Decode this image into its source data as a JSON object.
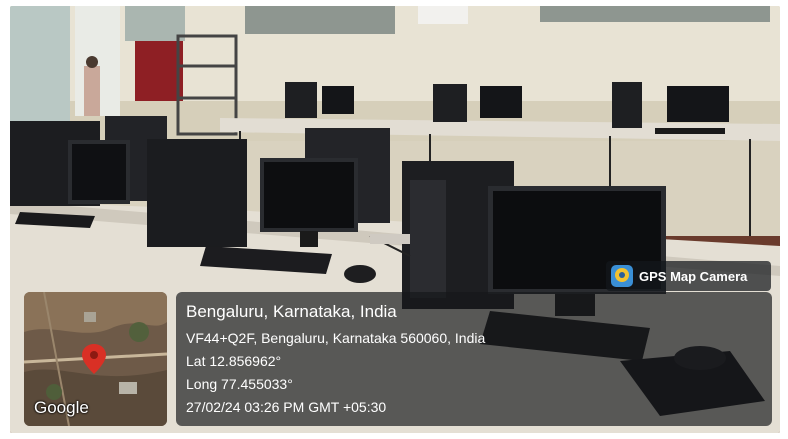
{
  "badge": {
    "label": "GPS Map Camera",
    "icon": "gps-map-camera-logo-icon"
  },
  "map": {
    "attribution": "Google",
    "marker_icon": "location-pin-icon",
    "marker_color": "#d93025"
  },
  "location": {
    "city_line": "Bengaluru, Karnataka, India",
    "address": "VF44+Q2F, Bengaluru, Karnataka 560060, India",
    "latitude": "Lat 12.856962°",
    "longitude": "Long 77.455033°",
    "timestamp": "27/02/24 03:26 PM GMT +05:30"
  },
  "colors": {
    "overlay_bg": "#16181a",
    "overlay_text": "#ffffff"
  }
}
